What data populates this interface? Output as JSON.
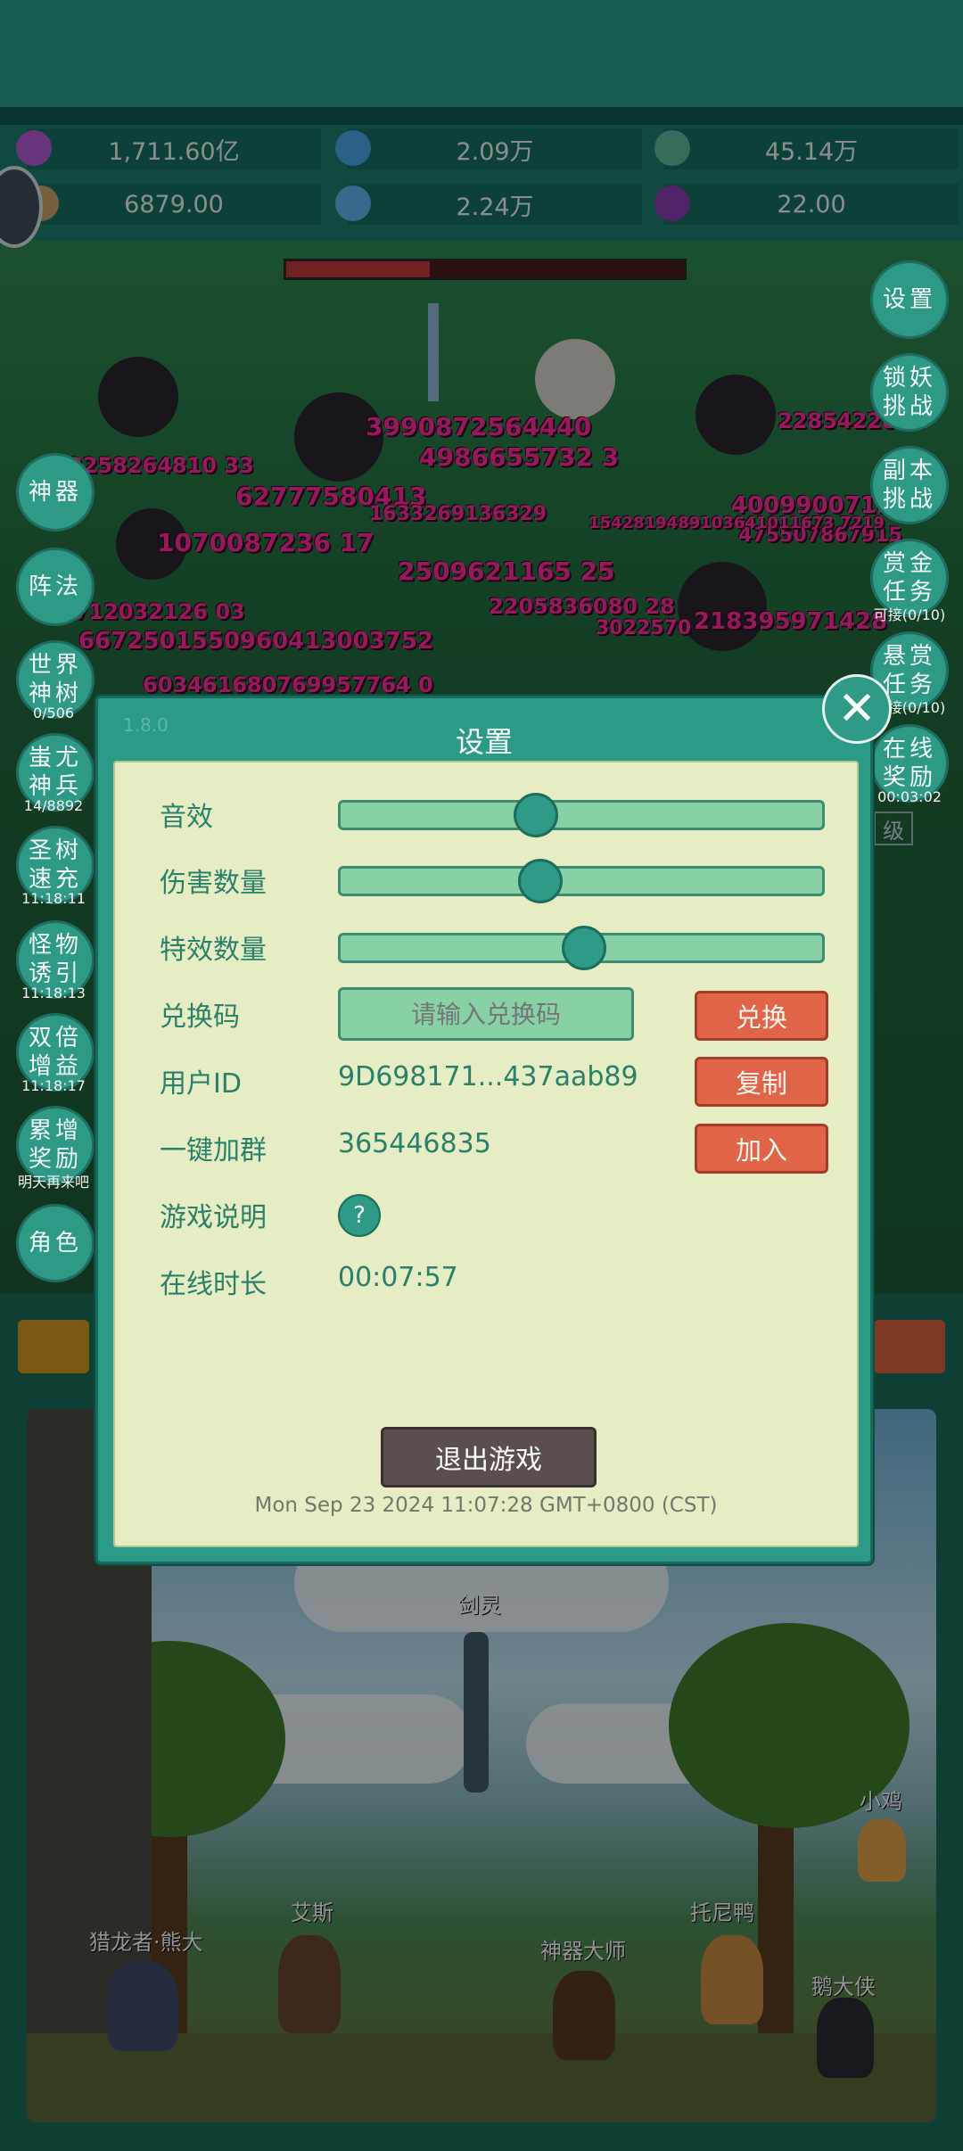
{
  "resources": [
    {
      "icon": "purple-gem-icon",
      "value": "1,711.60亿",
      "color": "#b45ad6"
    },
    {
      "icon": "blue-crystal-icon",
      "value": "2.09万",
      "color": "#4aa6e8"
    },
    {
      "icon": "green-orb-icon",
      "value": "45.14万",
      "color": "#5fb99b"
    },
    {
      "icon": "scroll-icon",
      "value": "6879.00",
      "color": "#c9a56a"
    },
    {
      "icon": "ice-shard-icon",
      "value": "2.24万",
      "color": "#62b6ee"
    },
    {
      "icon": "magic-pot-icon",
      "value": "22.00",
      "color": "#8b3fb0"
    }
  ],
  "left_buttons": [
    {
      "label": "神器",
      "sub": ""
    },
    {
      "label": "阵法",
      "sub": ""
    },
    {
      "label": "世界神树",
      "sub": "0/506"
    },
    {
      "label": "蚩尤神兵",
      "sub": "14/8892"
    },
    {
      "label": "圣树速充",
      "sub": "11:18:11"
    },
    {
      "label": "怪物诱引",
      "sub": "11:18:13"
    },
    {
      "label": "双倍增益",
      "sub": "11:18:17"
    },
    {
      "label": "累增奖励",
      "sub": "明天再来吧"
    },
    {
      "label": "角色",
      "sub": ""
    }
  ],
  "right_buttons": [
    {
      "label": "设置",
      "sub": ""
    },
    {
      "label": "锁妖挑战",
      "sub": ""
    },
    {
      "label": "副本挑战",
      "sub": ""
    },
    {
      "label": "赏金任务",
      "sub": "可接(0/10)"
    },
    {
      "label": "悬赏任务",
      "sub": "可接(0/10)"
    },
    {
      "label": "在线奖励",
      "sub": "00:03:02"
    }
  ],
  "damage_numbers": [
    "3990872564440",
    "4986655732 3",
    "2285422843",
    "3258264810 33",
    "62777580413",
    "1633269136329",
    "1070087236 17",
    "2509621165 25",
    "4009900715",
    "475507867915",
    "2205836080 28",
    "218395971428",
    "6712032126 03",
    "6672501550960413003752",
    "603461680769957764 0",
    "1542819489103641011673 7219",
    "3022570"
  ],
  "dialog": {
    "version": "1.8.0",
    "title": "设置",
    "sound_label": "音效",
    "sound_value": 0.4,
    "damage_label": "伤害数量",
    "damage_value": 0.41,
    "effects_label": "特效数量",
    "effects_value": 0.5,
    "code_label": "兑换码",
    "code_placeholder": "请输入兑换码",
    "redeem_btn": "兑换",
    "uid_label": "用户ID",
    "uid_value": "9D698171...437aab89",
    "copy_btn": "复制",
    "group_label": "一键加群",
    "group_value": "365446835",
    "join_btn": "加入",
    "help_label": "游戏说明",
    "help_icon": "?",
    "online_label": "在线时长",
    "online_value": "00:07:57",
    "exit_btn": "退出游戏",
    "timestamp": "Mon Sep 23 2024 11:07:28 GMT+0800 (CST)"
  },
  "close_icon": "✕",
  "partial_label": "级",
  "heroes": [
    {
      "name": "剑灵"
    },
    {
      "name": "小鸡"
    },
    {
      "name": "艾斯"
    },
    {
      "name": "托尼鸭"
    },
    {
      "name": "猎龙者·熊大"
    },
    {
      "name": "神器大师"
    },
    {
      "name": "鹅大侠"
    }
  ]
}
